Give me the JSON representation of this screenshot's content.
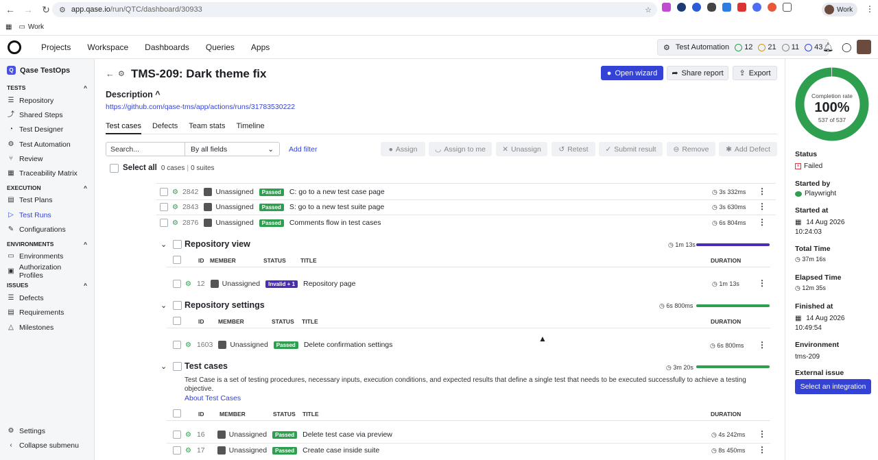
{
  "browser": {
    "url_host": "app.qase.io",
    "url_path": "/run/QTC/dashboard/30933",
    "profile": "Work",
    "bookmark": "Work"
  },
  "appbar": {
    "menu": [
      "Projects",
      "Workspace",
      "Dashboards",
      "Queries",
      "Apps"
    ],
    "automation": {
      "label": "Test Automation",
      "c1": "12",
      "c2": "21",
      "c3": "11",
      "c4": "43"
    }
  },
  "sidebar": {
    "project": "Qase TestOps",
    "sections": [
      {
        "title": "TESTS",
        "items": [
          "Repository",
          "Shared Steps",
          "Test Designer",
          "Test Automation",
          "Review",
          "Traceability Matrix"
        ]
      },
      {
        "title": "EXECUTION",
        "items": [
          "Test Plans",
          "Test Runs",
          "Configurations"
        ]
      },
      {
        "title": "ENVIRONMENTS",
        "items": [
          "Environments",
          "Authorization Profiles"
        ]
      },
      {
        "title": "ISSUES",
        "items": [
          "Defects",
          "Requirements",
          "Milestones"
        ]
      }
    ],
    "settings": "Settings",
    "collapse": "Collapse submenu"
  },
  "header": {
    "title": "TMS-209: Dark theme fix",
    "open_wizard": "Open wizard",
    "share_report": "Share report",
    "export": "Export",
    "description_label": "Description",
    "description_link": "https://github.com/qase-tms/app/actions/runs/31783530222"
  },
  "tabs": [
    "Test cases",
    "Defects",
    "Team stats",
    "Timeline"
  ],
  "toolbar": {
    "search_placeholder": "Search...",
    "field_select": "By all fields",
    "add_filter": "Add filter",
    "assign": "Assign",
    "assign_to_me": "Assign to me",
    "unassign": "Unassign",
    "retest": "Retest",
    "submit_result": "Submit result",
    "remove": "Remove",
    "add_defect": "Add Defect"
  },
  "selection": {
    "select_all": "Select all",
    "cases": "0 cases",
    "suites": "0 suites"
  },
  "columns": {
    "id": "ID",
    "member": "MEMBER",
    "status": "STATUS",
    "title": "TITLE",
    "duration": "DURATION"
  },
  "top_rows": [
    {
      "id": "2842",
      "member": "Unassigned",
      "status": "Passed",
      "title": "C: go to a new test case page",
      "duration": "3s 332ms"
    },
    {
      "id": "2843",
      "member": "Unassigned",
      "status": "Passed",
      "title": "S: go to a new test suite page",
      "duration": "3s 630ms"
    },
    {
      "id": "2876",
      "member": "Unassigned",
      "status": "Passed",
      "title": "Comments flow in test cases",
      "duration": "6s 804ms"
    }
  ],
  "suites": [
    {
      "name": "Repository view",
      "duration": "1m 13s",
      "progress": 1.0,
      "bar_color": "#4a2db3",
      "rows": [
        {
          "id": "12",
          "member": "Unassigned",
          "status": "Invalid + 1",
          "title": "Repository page",
          "duration": "1m 13s"
        }
      ]
    },
    {
      "name": "Repository settings",
      "duration": "6s 800ms",
      "progress": 1.0,
      "bar_color": "#2e9e4f",
      "rows": [
        {
          "id": "1603",
          "member": "Unassigned",
          "status": "Passed",
          "title": "Delete confirmation settings",
          "duration": "6s 800ms"
        }
      ]
    },
    {
      "name": "Test cases",
      "duration": "3m 20s",
      "progress": 1.0,
      "bar_color": "#2e9e4f",
      "description": "Test Case is a set of testing procedures, necessary inputs, execution conditions, and expected results that define a single test that needs to be executed successfully to achieve a testing objective.",
      "about_link": "About Test Cases",
      "rows": [
        {
          "id": "16",
          "member": "Unassigned",
          "status": "Passed",
          "title": "Delete test case via preview",
          "duration": "4s 242ms"
        },
        {
          "id": "17",
          "member": "Unassigned",
          "status": "Passed",
          "title": "Create case inside suite",
          "duration": "8s 450ms"
        }
      ]
    }
  ],
  "right_panel": {
    "completion_label": "Completion rate",
    "completion_pct": "100%",
    "completion_count": "537 of 537",
    "completion_value": 1.0,
    "status_label": "Status",
    "status": "Failed",
    "started_by_label": "Started by",
    "started_by": "Playwright",
    "started_at_label": "Started at",
    "started_at_date": "14 Aug 2026",
    "started_at_time": "10:24:03",
    "total_time_label": "Total Time",
    "total_time": "37m 16s",
    "elapsed_label": "Elapsed Time",
    "elapsed": "12m 35s",
    "finished_label": "Finished at",
    "finished_date": "14 Aug 2026",
    "finished_time": "10:49:54",
    "env_label": "Environment",
    "env": "tms-209",
    "ext_issue_label": "External issue",
    "ext_issue_button": "Select an integration"
  },
  "colors": {
    "accent": "#3443d6",
    "passed": "#2e9e4f",
    "invalid": "#4a2db3",
    "failed": "#d9363e"
  }
}
